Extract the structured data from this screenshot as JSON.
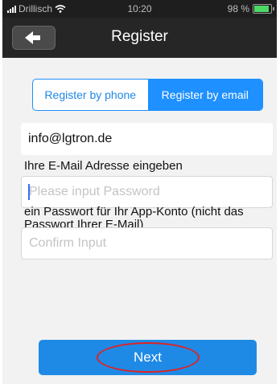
{
  "status_bar": {
    "carrier": "Drillisch",
    "time": "10:20",
    "battery_percent": "98 %",
    "battery_level": 0.98,
    "icons": [
      "signal-icon",
      "wifi-icon",
      "battery-icon"
    ]
  },
  "nav": {
    "title": "Register",
    "back_icon": "back-arrow-icon"
  },
  "tabs": [
    {
      "label": "Register by phone",
      "selected": false
    },
    {
      "label": "Register by email",
      "selected": true
    }
  ],
  "form": {
    "email_value": "info@lgtron.de",
    "email_hint": "Ihre E-Mail Adresse eingeben",
    "password_placeholder": "Please input Password",
    "password_hint": "ein Passwort für Ihr App-Konto (nicht das Passwort Ihrer E-Mail)",
    "confirm_placeholder": "Confirm Input"
  },
  "actions": {
    "next_label": "Next"
  },
  "colors": {
    "accent": "#1e8ae6",
    "nav_background": "#262626",
    "highlight": "#e02222"
  }
}
